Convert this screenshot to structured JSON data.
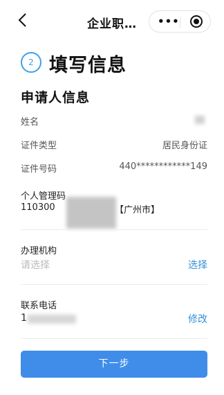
{
  "nav": {
    "title": "企业职…",
    "more": "•••"
  },
  "step": {
    "number": "2",
    "title": "填写信息"
  },
  "section": {
    "title": "申请人信息"
  },
  "fields": {
    "name_label": "姓名",
    "id_type_label": "证件类型",
    "id_type_value": "居民身份证",
    "id_number_label": "证件号码",
    "id_number_value": "440************149",
    "mgmt_code_label": "个人管理码",
    "mgmt_code_prefix": "110300",
    "mgmt_code_suffix": "【广州市】",
    "agency_label": "办理机构",
    "agency_placeholder": "请选择",
    "agency_action": "选择",
    "phone_label": "联系电话",
    "phone_prefix": "1",
    "phone_action": "修改"
  },
  "next_button": "下一步",
  "colors": {
    "accent": "#3f8de9",
    "link": "#3591d8",
    "step_ring": "#3fa0e8"
  }
}
